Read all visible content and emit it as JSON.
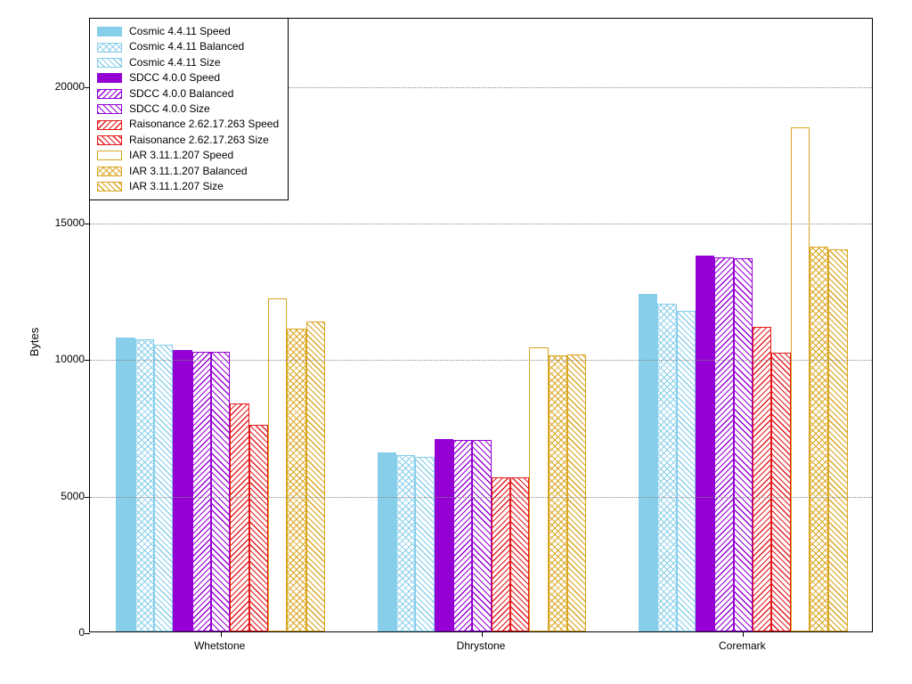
{
  "chart_data": {
    "type": "bar",
    "title": "",
    "xlabel": "",
    "ylabel": "Bytes",
    "ylim": [
      0,
      22500
    ],
    "yticks": [
      0,
      5000,
      10000,
      15000,
      20000
    ],
    "categories": [
      "Whetstone",
      "Dhrystone",
      "Coremark"
    ],
    "series": [
      {
        "name": "Cosmic 4.4.11 Speed",
        "style": "pat-solid-skyblue"
      },
      {
        "name": "Cosmic 4.4.11 Balanced",
        "style": "pat-cross-skyblue"
      },
      {
        "name": "Cosmic 4.4.11 Size",
        "style": "pat-diag-skyblue"
      },
      {
        "name": "SDCC 4.0.0 Speed",
        "style": "pat-solid-darkviolet"
      },
      {
        "name": "SDCC 4.0.0 Balanced",
        "style": "pat-diag-darkviolet"
      },
      {
        "name": "SDCC 4.0.0 Size",
        "style": "pat-diagr-darkviolet"
      },
      {
        "name": "Raisonance 2.62.17.263 Speed",
        "style": "pat-diag-red"
      },
      {
        "name": "Raisonance 2.62.17.263 Size",
        "style": "pat-diagr-red"
      },
      {
        "name": "IAR 3.11.1.207 Speed",
        "style": "pat-solid-goldenrod"
      },
      {
        "name": "IAR 3.11.1.207 Balanced",
        "style": "pat-cross-goldenrod"
      },
      {
        "name": "IAR 3.11.1.207 Size",
        "style": "pat-diag-goldenrod"
      }
    ],
    "values": {
      "Whetstone": [
        10750,
        10700,
        10500,
        10300,
        10250,
        10250,
        8350,
        7550,
        12200,
        11100,
        11350
      ],
      "Dhrystone": [
        6550,
        6450,
        6400,
        7050,
        7000,
        7000,
        5650,
        5650,
        10400,
        10100,
        10150
      ],
      "Coremark": [
        12350,
        12000,
        11750,
        13750,
        13700,
        13650,
        11150,
        10200,
        18450,
        14100,
        14000
      ]
    },
    "legend_position": "top-left"
  }
}
